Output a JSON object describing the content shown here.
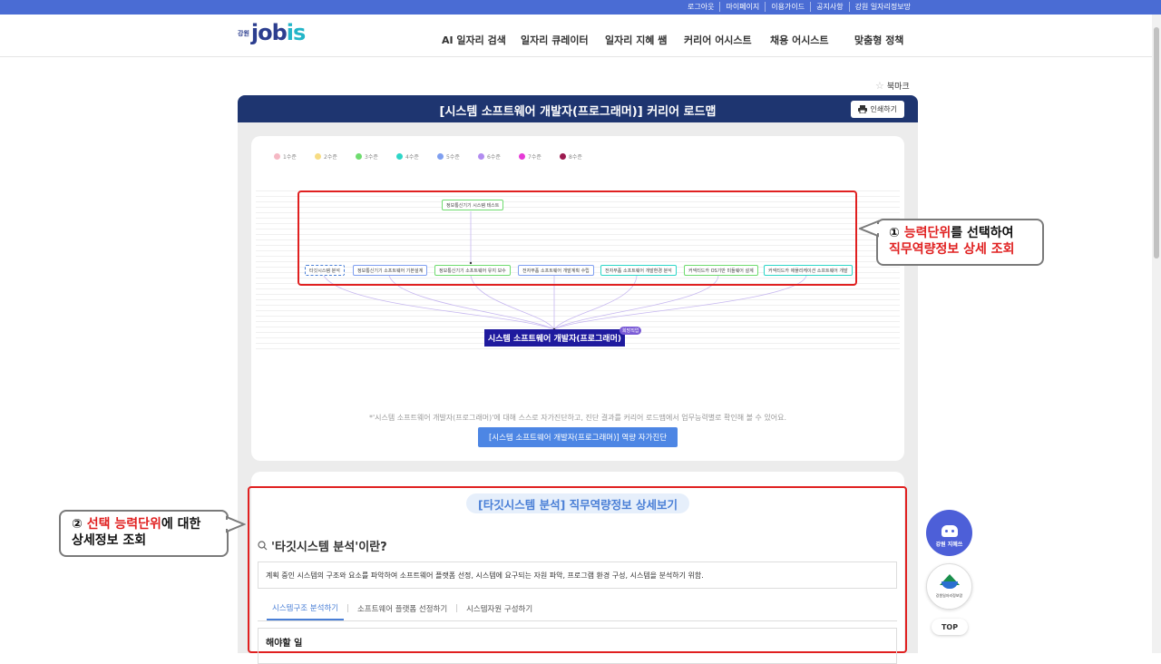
{
  "topbar": {
    "links": [
      "로그아웃",
      "마이페이지",
      "이용가이드",
      "공지사항",
      "강원 일자리정보망"
    ]
  },
  "logo": {
    "prefix": "강원",
    "name_main": "job",
    "name_accent": "is"
  },
  "nav": [
    "AI 일자리 검색",
    "일자리 큐레이터",
    "일자리 지혜 쌤",
    "커리어 어시스트",
    "채용 어시스트",
    "맞춤형 정책"
  ],
  "bookmark": {
    "label": "북마크",
    "icon": "star-icon"
  },
  "panel": {
    "title": "[시스템 소프트웨어 개발자(프로그래머)] 커리어 로드맵",
    "print_label": "인쇄하기"
  },
  "legend": [
    {
      "label": "1수준",
      "color": "#f5b8c4"
    },
    {
      "label": "2수준",
      "color": "#f7dc83"
    },
    {
      "label": "3수준",
      "color": "#6fdc6f"
    },
    {
      "label": "4수준",
      "color": "#2ed6c8"
    },
    {
      "label": "5수준",
      "color": "#7f9ff0"
    },
    {
      "label": "6수준",
      "color": "#b28cf0"
    },
    {
      "label": "7수준",
      "color": "#e63ad6"
    },
    {
      "label": "8수준",
      "color": "#9c1a4f"
    }
  ],
  "roadmap": {
    "top_node": {
      "label": "정보통신기기 시스템 테스트",
      "color": "#6fdc6f"
    },
    "nodes": [
      {
        "label": "타깃시스템 분석",
        "color": "#7f9ff0",
        "dashed": true
      },
      {
        "label": "정보통신기기 소프트웨어 기본설계",
        "color": "#7f9ff0"
      },
      {
        "label": "정보통신기기 소프트웨어 유지 보수",
        "color": "#6fdc6f"
      },
      {
        "label": "전자부품 소프트웨어 개발계획 수립",
        "color": "#7f9ff0"
      },
      {
        "label": "전자부품 소프트웨어 개발환경 분석",
        "color": "#2ed6c8"
      },
      {
        "label": "커넥티드카 OS기반 미들웨어 설계",
        "color": "#6fdc6f"
      },
      {
        "label": "커넥티드카 애플리케이션 소프트웨어 개발",
        "color": "#2ed6c8"
      }
    ],
    "job": "시스템 소프트웨어 개발자(프로그래머)",
    "job_badge": "희망직업"
  },
  "hint": "*'시스템 소프트웨어 개발자(프로그래머)'에 대해 스스로 자가진단하고, 진단 결과를 커리어 로드맵에서 업무능력별로 확인해 볼 수 있어요.",
  "diag_button": "[시스템 소프트웨어 개발자(프로그래머)] 역량 자가진단",
  "callout1": {
    "num": "①",
    "red1": "능력단위",
    "text1": "를 선택하여",
    "red2": "직무역량정보 상세 조회"
  },
  "callout2": {
    "num": "②",
    "red1": "선택 능력단위",
    "text1": "에 대한",
    "line2": "상세정보 조회"
  },
  "detail": {
    "title": "[타깃시스템 분석] 직무역량정보 상세보기",
    "question": "'타깃시스템 분석'이란?",
    "description": "계획 중인 시스템의 구조와 요소를 파악하여 소프트웨어 플랫폼 선정, 시스템에 요구되는 자원 파악, 프로그램 환경 구성, 시스템을 분석하기 위함.",
    "tabs": [
      "시스템구조 분석하기",
      "소프트웨어 플랫폼 선정하기",
      "시스템자원 구성하기"
    ],
    "todo_title": "해야할 일"
  },
  "fab": {
    "assistant": "강원 지혜쓰",
    "gov": "강원일자리정보망",
    "top": "TOP"
  }
}
